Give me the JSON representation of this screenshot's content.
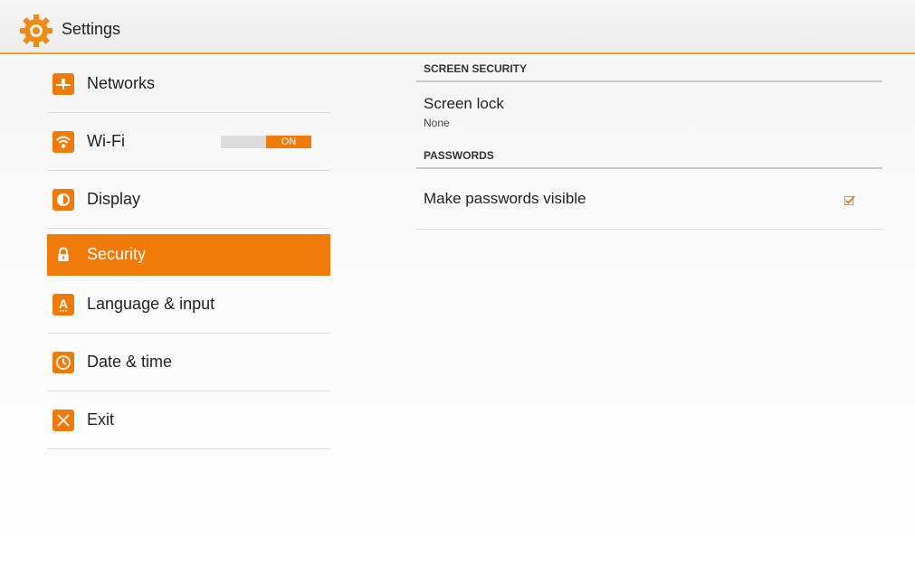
{
  "app": {
    "title": "Settings"
  },
  "menu": {
    "items": [
      {
        "label": "Networks"
      },
      {
        "label": "Wi-Fi",
        "toggle": "ON"
      },
      {
        "label": "Display"
      },
      {
        "label": "Security",
        "active": true
      },
      {
        "label": "Language & input"
      },
      {
        "label": "Date & time"
      },
      {
        "label": "Exit"
      }
    ]
  },
  "security": {
    "screen_security_header": "SCREEN SECURITY",
    "screen_lock": {
      "title": "Screen lock",
      "summary": "None"
    },
    "passwords_header": "PASSWORDS",
    "make_passwords_visible": {
      "title": "Make passwords visible",
      "checked": true
    }
  },
  "colors": {
    "accent": "#f07a08",
    "header_divider": "#c8c8c8"
  },
  "icons": [
    "settings-gear-icon",
    "network-plug-icon",
    "wifi-icon",
    "display-brightness-icon",
    "lock-icon",
    "language-a-icon",
    "clock-icon",
    "exit-x-icon",
    "checkbox-checked-icon"
  ]
}
